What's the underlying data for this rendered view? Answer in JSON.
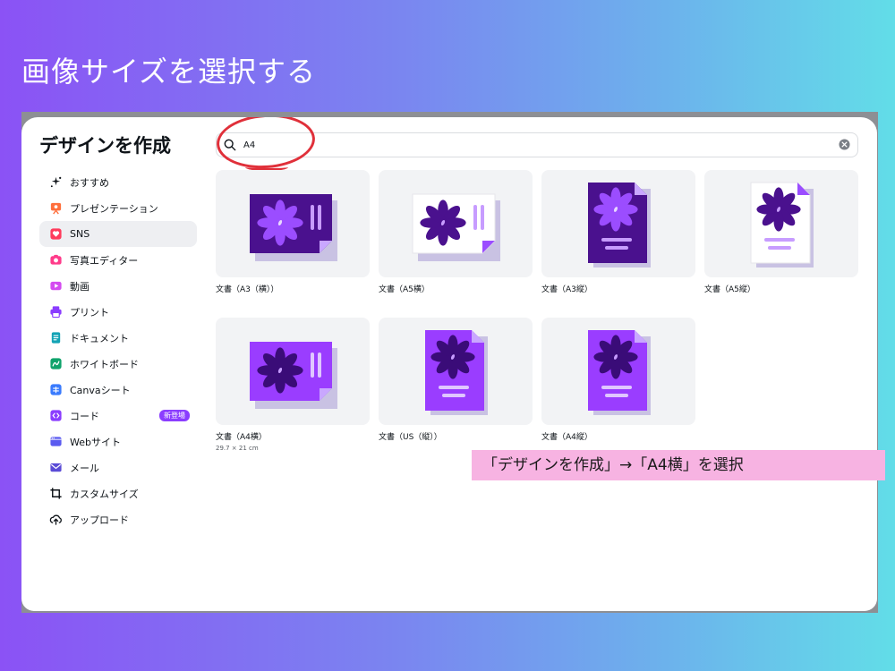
{
  "slide": {
    "title": "画像サイズを選択する",
    "note": "「デザインを作成」→「A4横」を選択"
  },
  "panel": {
    "title": "デザインを作成",
    "search": {
      "value": "A4",
      "placeholder": ""
    },
    "sidebar": [
      {
        "label": "おすすめ",
        "icon": "sparkle-icon",
        "color": "#0e1318"
      },
      {
        "label": "プレゼンテーション",
        "icon": "presentation-icon",
        "color": "#ff6f3c"
      },
      {
        "label": "SNS",
        "icon": "heart-icon",
        "color": "#ff3b5c",
        "active": true
      },
      {
        "label": "写真エディター",
        "icon": "camera-icon",
        "color": "#ff3b8a"
      },
      {
        "label": "動画",
        "icon": "video-icon",
        "color": "#d44bf0"
      },
      {
        "label": "プリント",
        "icon": "printer-icon",
        "color": "#8b3dff"
      },
      {
        "label": "ドキュメント",
        "icon": "document-icon",
        "color": "#13a3b5"
      },
      {
        "label": "ホワイトボード",
        "icon": "whiteboard-icon",
        "color": "#0fa36b"
      },
      {
        "label": "Canvaシート",
        "icon": "sheet-icon",
        "color": "#3a7bfd"
      },
      {
        "label": "コード",
        "icon": "code-icon",
        "color": "#8b3dff",
        "badge": "新登場"
      },
      {
        "label": "Webサイト",
        "icon": "website-icon",
        "color": "#5b5bf0"
      },
      {
        "label": "メール",
        "icon": "mail-icon",
        "color": "#5a4bd6"
      },
      {
        "label": "カスタムサイズ",
        "icon": "custom-size-icon",
        "color": "#0e1318"
      },
      {
        "label": "アップロード",
        "icon": "upload-icon",
        "color": "#0e1318"
      }
    ],
    "cards": [
      {
        "label": "文書（A3（横））",
        "sub": "",
        "orientation": "landscape",
        "style": "dark"
      },
      {
        "label": "文書（A5横）",
        "sub": "",
        "orientation": "landscape",
        "style": "white"
      },
      {
        "label": "文書（A3縦）",
        "sub": "",
        "orientation": "portrait",
        "style": "dark"
      },
      {
        "label": "文書（A5縦）",
        "sub": "",
        "orientation": "portrait",
        "style": "white"
      },
      {
        "label": "文書（A4横）",
        "sub": "29.7 × 21 cm",
        "orientation": "landscape",
        "style": "bright"
      },
      {
        "label": "文書（US（縦））",
        "sub": "",
        "orientation": "portrait",
        "style": "bright"
      },
      {
        "label": "文書（A4縦）",
        "sub": "",
        "orientation": "portrait",
        "style": "bright"
      }
    ]
  },
  "colors": {
    "accent": "#8b3dff",
    "annotation_red": "#e0303a",
    "note_bg": "#f7b3e2"
  }
}
